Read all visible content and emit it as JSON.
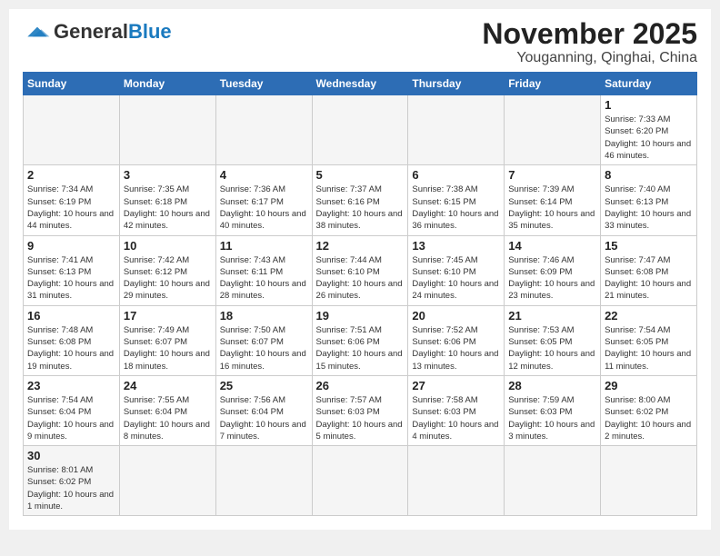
{
  "header": {
    "logo_general": "General",
    "logo_blue": "Blue",
    "month_title": "November 2025",
    "location": "Youganning, Qinghai, China"
  },
  "weekdays": [
    "Sunday",
    "Monday",
    "Tuesday",
    "Wednesday",
    "Thursday",
    "Friday",
    "Saturday"
  ],
  "weeks": [
    [
      {
        "day": "",
        "empty": true
      },
      {
        "day": "",
        "empty": true
      },
      {
        "day": "",
        "empty": true
      },
      {
        "day": "",
        "empty": true
      },
      {
        "day": "",
        "empty": true
      },
      {
        "day": "",
        "empty": true
      },
      {
        "day": "1",
        "sunrise": "Sunrise: 7:33 AM",
        "sunset": "Sunset: 6:20 PM",
        "daylight": "Daylight: 10 hours and 46 minutes."
      }
    ],
    [
      {
        "day": "2",
        "sunrise": "Sunrise: 7:34 AM",
        "sunset": "Sunset: 6:19 PM",
        "daylight": "Daylight: 10 hours and 44 minutes."
      },
      {
        "day": "3",
        "sunrise": "Sunrise: 7:35 AM",
        "sunset": "Sunset: 6:18 PM",
        "daylight": "Daylight: 10 hours and 42 minutes."
      },
      {
        "day": "4",
        "sunrise": "Sunrise: 7:36 AM",
        "sunset": "Sunset: 6:17 PM",
        "daylight": "Daylight: 10 hours and 40 minutes."
      },
      {
        "day": "5",
        "sunrise": "Sunrise: 7:37 AM",
        "sunset": "Sunset: 6:16 PM",
        "daylight": "Daylight: 10 hours and 38 minutes."
      },
      {
        "day": "6",
        "sunrise": "Sunrise: 7:38 AM",
        "sunset": "Sunset: 6:15 PM",
        "daylight": "Daylight: 10 hours and 36 minutes."
      },
      {
        "day": "7",
        "sunrise": "Sunrise: 7:39 AM",
        "sunset": "Sunset: 6:14 PM",
        "daylight": "Daylight: 10 hours and 35 minutes."
      },
      {
        "day": "8",
        "sunrise": "Sunrise: 7:40 AM",
        "sunset": "Sunset: 6:13 PM",
        "daylight": "Daylight: 10 hours and 33 minutes."
      }
    ],
    [
      {
        "day": "9",
        "sunrise": "Sunrise: 7:41 AM",
        "sunset": "Sunset: 6:13 PM",
        "daylight": "Daylight: 10 hours and 31 minutes."
      },
      {
        "day": "10",
        "sunrise": "Sunrise: 7:42 AM",
        "sunset": "Sunset: 6:12 PM",
        "daylight": "Daylight: 10 hours and 29 minutes."
      },
      {
        "day": "11",
        "sunrise": "Sunrise: 7:43 AM",
        "sunset": "Sunset: 6:11 PM",
        "daylight": "Daylight: 10 hours and 28 minutes."
      },
      {
        "day": "12",
        "sunrise": "Sunrise: 7:44 AM",
        "sunset": "Sunset: 6:10 PM",
        "daylight": "Daylight: 10 hours and 26 minutes."
      },
      {
        "day": "13",
        "sunrise": "Sunrise: 7:45 AM",
        "sunset": "Sunset: 6:10 PM",
        "daylight": "Daylight: 10 hours and 24 minutes."
      },
      {
        "day": "14",
        "sunrise": "Sunrise: 7:46 AM",
        "sunset": "Sunset: 6:09 PM",
        "daylight": "Daylight: 10 hours and 23 minutes."
      },
      {
        "day": "15",
        "sunrise": "Sunrise: 7:47 AM",
        "sunset": "Sunset: 6:08 PM",
        "daylight": "Daylight: 10 hours and 21 minutes."
      }
    ],
    [
      {
        "day": "16",
        "sunrise": "Sunrise: 7:48 AM",
        "sunset": "Sunset: 6:08 PM",
        "daylight": "Daylight: 10 hours and 19 minutes."
      },
      {
        "day": "17",
        "sunrise": "Sunrise: 7:49 AM",
        "sunset": "Sunset: 6:07 PM",
        "daylight": "Daylight: 10 hours and 18 minutes."
      },
      {
        "day": "18",
        "sunrise": "Sunrise: 7:50 AM",
        "sunset": "Sunset: 6:07 PM",
        "daylight": "Daylight: 10 hours and 16 minutes."
      },
      {
        "day": "19",
        "sunrise": "Sunrise: 7:51 AM",
        "sunset": "Sunset: 6:06 PM",
        "daylight": "Daylight: 10 hours and 15 minutes."
      },
      {
        "day": "20",
        "sunrise": "Sunrise: 7:52 AM",
        "sunset": "Sunset: 6:06 PM",
        "daylight": "Daylight: 10 hours and 13 minutes."
      },
      {
        "day": "21",
        "sunrise": "Sunrise: 7:53 AM",
        "sunset": "Sunset: 6:05 PM",
        "daylight": "Daylight: 10 hours and 12 minutes."
      },
      {
        "day": "22",
        "sunrise": "Sunrise: 7:54 AM",
        "sunset": "Sunset: 6:05 PM",
        "daylight": "Daylight: 10 hours and 11 minutes."
      }
    ],
    [
      {
        "day": "23",
        "sunrise": "Sunrise: 7:54 AM",
        "sunset": "Sunset: 6:04 PM",
        "daylight": "Daylight: 10 hours and 9 minutes."
      },
      {
        "day": "24",
        "sunrise": "Sunrise: 7:55 AM",
        "sunset": "Sunset: 6:04 PM",
        "daylight": "Daylight: 10 hours and 8 minutes."
      },
      {
        "day": "25",
        "sunrise": "Sunrise: 7:56 AM",
        "sunset": "Sunset: 6:04 PM",
        "daylight": "Daylight: 10 hours and 7 minutes."
      },
      {
        "day": "26",
        "sunrise": "Sunrise: 7:57 AM",
        "sunset": "Sunset: 6:03 PM",
        "daylight": "Daylight: 10 hours and 5 minutes."
      },
      {
        "day": "27",
        "sunrise": "Sunrise: 7:58 AM",
        "sunset": "Sunset: 6:03 PM",
        "daylight": "Daylight: 10 hours and 4 minutes."
      },
      {
        "day": "28",
        "sunrise": "Sunrise: 7:59 AM",
        "sunset": "Sunset: 6:03 PM",
        "daylight": "Daylight: 10 hours and 3 minutes."
      },
      {
        "day": "29",
        "sunrise": "Sunrise: 8:00 AM",
        "sunset": "Sunset: 6:02 PM",
        "daylight": "Daylight: 10 hours and 2 minutes."
      }
    ],
    [
      {
        "day": "30",
        "sunrise": "Sunrise: 8:01 AM",
        "sunset": "Sunset: 6:02 PM",
        "daylight": "Daylight: 10 hours and 1 minute.",
        "last": true
      },
      {
        "day": "",
        "empty": true,
        "last": true
      },
      {
        "day": "",
        "empty": true,
        "last": true
      },
      {
        "day": "",
        "empty": true,
        "last": true
      },
      {
        "day": "",
        "empty": true,
        "last": true
      },
      {
        "day": "",
        "empty": true,
        "last": true
      },
      {
        "day": "",
        "empty": true,
        "last": true
      }
    ]
  ]
}
